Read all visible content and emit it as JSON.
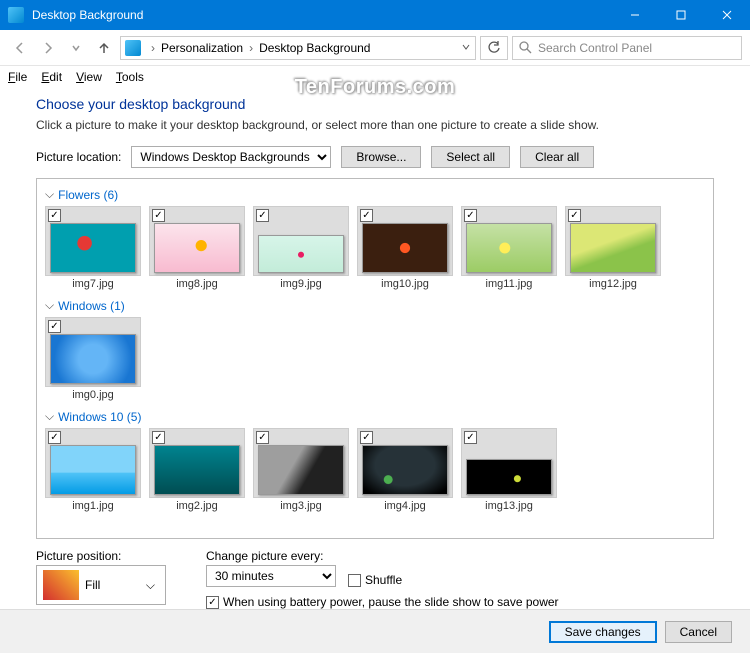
{
  "window": {
    "title": "Desktop Background"
  },
  "nav": {
    "breadcrumb": [
      "Personalization",
      "Desktop Background"
    ],
    "search_placeholder": "Search Control Panel"
  },
  "menu": {
    "file": "File",
    "edit": "Edit",
    "view": "View",
    "tools": "Tools"
  },
  "heading": "Choose your desktop background",
  "subtext": "Click a picture to make it your desktop background, or select more than one picture to create a slide show.",
  "location": {
    "label": "Picture location:",
    "value": "Windows Desktop Backgrounds",
    "browse": "Browse...",
    "select_all": "Select all",
    "clear_all": "Clear all"
  },
  "groups": [
    {
      "name": "Flowers",
      "count": 6,
      "items": [
        {
          "file": "img7.jpg",
          "cls": "p-img7"
        },
        {
          "file": "img8.jpg",
          "cls": "p-img8"
        },
        {
          "file": "img9.jpg",
          "cls": "p-img9"
        },
        {
          "file": "img10.jpg",
          "cls": "p-img10"
        },
        {
          "file": "img11.jpg",
          "cls": "p-img11"
        },
        {
          "file": "img12.jpg",
          "cls": "p-img12"
        }
      ]
    },
    {
      "name": "Windows",
      "count": 1,
      "items": [
        {
          "file": "img0.jpg",
          "cls": "p-img0"
        }
      ]
    },
    {
      "name": "Windows 10",
      "count": 5,
      "items": [
        {
          "file": "img1.jpg",
          "cls": "p-img1"
        },
        {
          "file": "img2.jpg",
          "cls": "p-img2"
        },
        {
          "file": "img3.jpg",
          "cls": "p-img3"
        },
        {
          "file": "img4.jpg",
          "cls": "p-img4"
        },
        {
          "file": "img13.jpg",
          "cls": "p-img13"
        }
      ]
    }
  ],
  "position": {
    "label": "Picture position:",
    "value": "Fill"
  },
  "change": {
    "label": "Change picture every:",
    "value": "30 minutes",
    "shuffle": "Shuffle",
    "battery": "When using battery power, pause the slide show to save power"
  },
  "footer": {
    "save": "Save changes",
    "cancel": "Cancel"
  },
  "watermark": "TenForums.com"
}
